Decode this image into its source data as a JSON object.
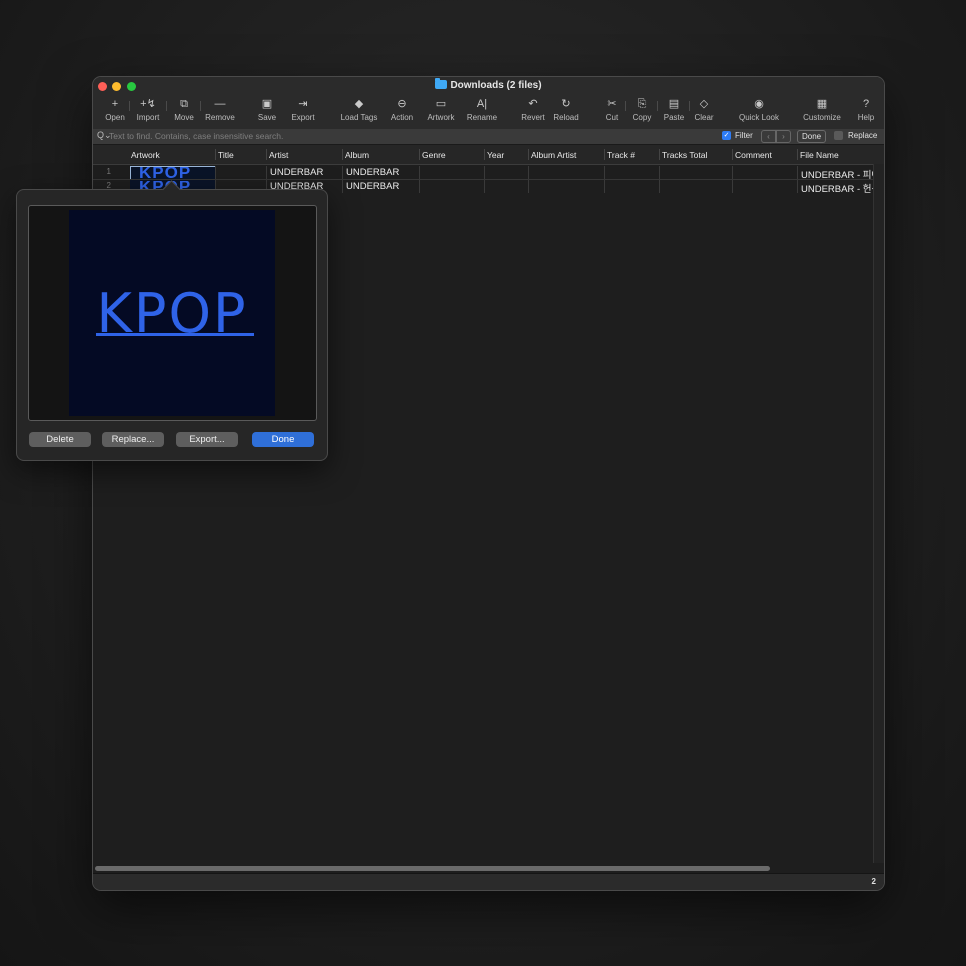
{
  "window": {
    "title": "Downloads (2 files)"
  },
  "toolbar": [
    {
      "label": "Open",
      "icon": "+"
    },
    {
      "label": "Import",
      "icon": "+↯"
    },
    {
      "label": "Move",
      "icon": "⧉"
    },
    {
      "label": "Remove",
      "icon": "—"
    },
    {
      "label": "Save",
      "icon": "▣"
    },
    {
      "label": "Export",
      "icon": "⇥"
    },
    {
      "label": "Load Tags",
      "icon": "◆"
    },
    {
      "label": "Action",
      "icon": "⊖"
    },
    {
      "label": "Artwork",
      "icon": "▭"
    },
    {
      "label": "Rename",
      "icon": "A|"
    },
    {
      "label": "Revert",
      "icon": "↶"
    },
    {
      "label": "Reload",
      "icon": "↻"
    },
    {
      "label": "Cut",
      "icon": "✂"
    },
    {
      "label": "Copy",
      "icon": "⎘"
    },
    {
      "label": "Paste",
      "icon": "▤"
    },
    {
      "label": "Clear",
      "icon": "◇"
    },
    {
      "label": "Quick Look",
      "icon": "◉"
    },
    {
      "label": "Customize",
      "icon": "▦"
    },
    {
      "label": "Help",
      "icon": "?"
    }
  ],
  "findbar": {
    "placeholder": "Text to find. Contains, case insensitive search.",
    "filter_label": "Filter",
    "done_label": "Done",
    "replace_label": "Replace"
  },
  "columns": [
    "Artwork",
    "Title",
    "Artist",
    "Album",
    "Genre",
    "Year",
    "Album Artist",
    "Track #",
    "Tracks Total",
    "Comment",
    "File Name"
  ],
  "rows": [
    {
      "num": "1",
      "artwork": "KPOP",
      "title": "",
      "artist": "UNDERBAR",
      "album": "UNDERBAR",
      "genre": "",
      "year": "",
      "album_artist": "",
      "track": "",
      "tracks_total": "",
      "comment": "",
      "file_name": "UNDERBAR - 피아"
    },
    {
      "num": "2",
      "artwork": "KPOP",
      "title": "",
      "artist": "UNDERBAR",
      "album": "UNDERBAR",
      "genre": "",
      "year": "",
      "album_artist": "",
      "track": "",
      "tracks_total": "",
      "comment": "",
      "file_name": "UNDERBAR - 헌신"
    }
  ],
  "status": {
    "count": "2"
  },
  "popover": {
    "artwork_text": "KPOP",
    "buttons": {
      "delete": "Delete",
      "replace": "Replace...",
      "export": "Export...",
      "done": "Done"
    }
  },
  "colors": {
    "accent": "#2f6fd8",
    "artwork_blue": "#2f63e8",
    "artwork_bg": "#040a24"
  }
}
